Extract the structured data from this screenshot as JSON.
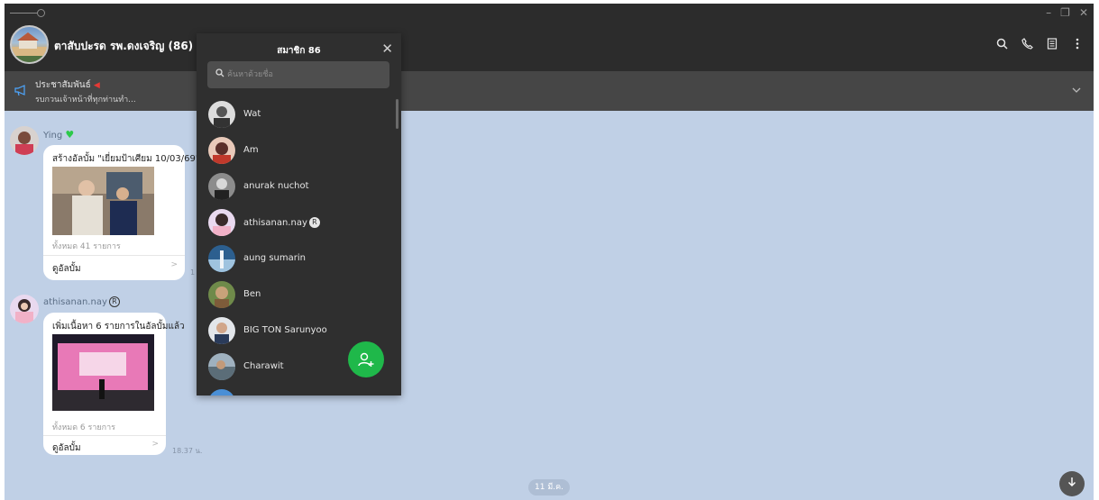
{
  "header": {
    "group_name": "ตาสับปะรด รพ.ดงเจริญ (86)",
    "window_controls": [
      "minimize-icon",
      "restore-icon",
      "close-icon"
    ],
    "icons": [
      "search-icon",
      "phone-icon",
      "notes-icon",
      "more-icon"
    ]
  },
  "announcement": {
    "title": "ประชาสัมพันธ์",
    "text": "รบกวนเจ้าหน้าที่ทุกท่านทำ..."
  },
  "messages": [
    {
      "sender": "Ying",
      "album_title": "สร้างอัลบั้ม \"เยี่ยมป้าเศียม 10/03/69\"",
      "count": "ทั้งหมด 41 รายการ",
      "view_label": "ดูอัลบั้ม",
      "time": "1"
    },
    {
      "sender": "athisanan.nay",
      "album_title": "เพิ่มเนื้อหา 6 รายการในอัลบั้มแล้ว",
      "count": "ทั้งหมด 6 รายการ",
      "view_label": "ดูอัลบั้ม",
      "time": "18.37 น."
    }
  ],
  "date_divider": "11 มี.ค.",
  "members_panel": {
    "title": "สมาชิก 86",
    "search_placeholder": "ค้นหาด้วยชื่อ",
    "members": [
      {
        "name": "Wat"
      },
      {
        "name": "Am"
      },
      {
        "name": "anurak nuchot"
      },
      {
        "name": "athisanan.nay"
      },
      {
        "name": "aung sumarin"
      },
      {
        "name": "Ben"
      },
      {
        "name": "BIG TON Sarunyoo"
      },
      {
        "name": "Charawit"
      }
    ]
  },
  "colors": {
    "titlebar": "#2c2c2c",
    "announcement": "#464646",
    "chat_background": "#c0d0e6",
    "panel": "#2f2f2f",
    "fab": "#1fb84a",
    "heart": "#2cc94a"
  }
}
